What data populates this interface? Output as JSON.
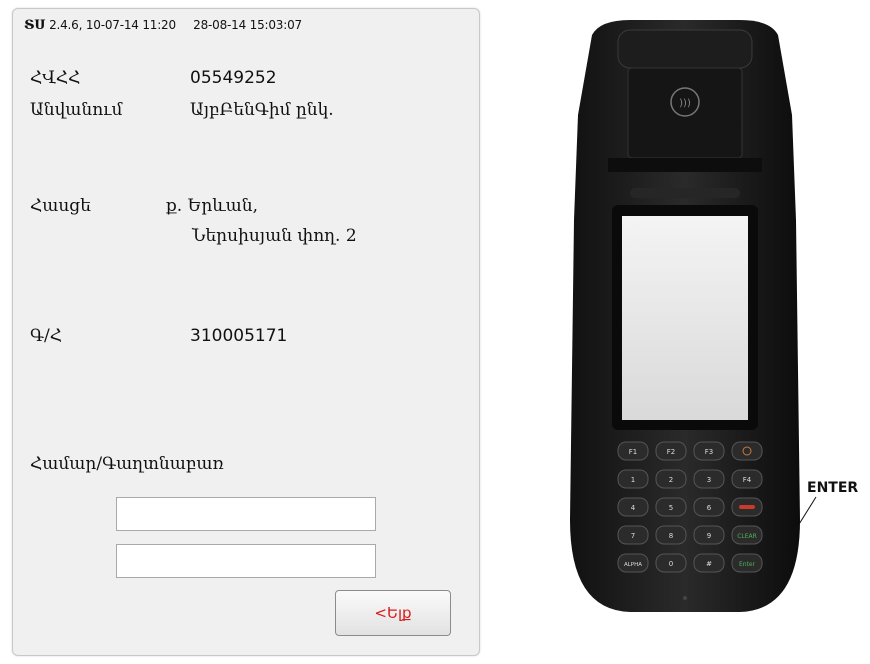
{
  "header": {
    "logo": "ՏՍ",
    "version": "2.4.6,",
    "date1": "10-07-14 11:20",
    "date2": "28-08-14 15:03:07"
  },
  "taxpayer": {
    "tin_label": "ՀՎՀՀ",
    "tin_value": "05549252",
    "name_label": "Անվանում",
    "name_value": "ԱյբԲենԳիմ ընկ.",
    "address_label": "Հասցե",
    "address_line1": "ք. Երևան,",
    "address_line2": "Ներսիսյան փող. 2",
    "gs_label": "Գ/Հ",
    "gs_value": "310005171"
  },
  "login": {
    "label": "Համար/Գաղտնաբառ",
    "number_value": "",
    "password_value": ""
  },
  "back_button": "<Ելք",
  "device": {
    "enter_label": "ENTER",
    "keys": [
      "F1",
      "F2",
      "F3",
      "1",
      "2",
      "3",
      "F4",
      "4",
      "5",
      "6",
      "7",
      "8",
      "9",
      "ALPHA",
      "0",
      "#",
      "CLEAR",
      "Enter"
    ],
    "colors": {
      "cancel": "#c83a2a",
      "clear": "#2f8a3a",
      "enter": "#2f8a3a"
    }
  }
}
